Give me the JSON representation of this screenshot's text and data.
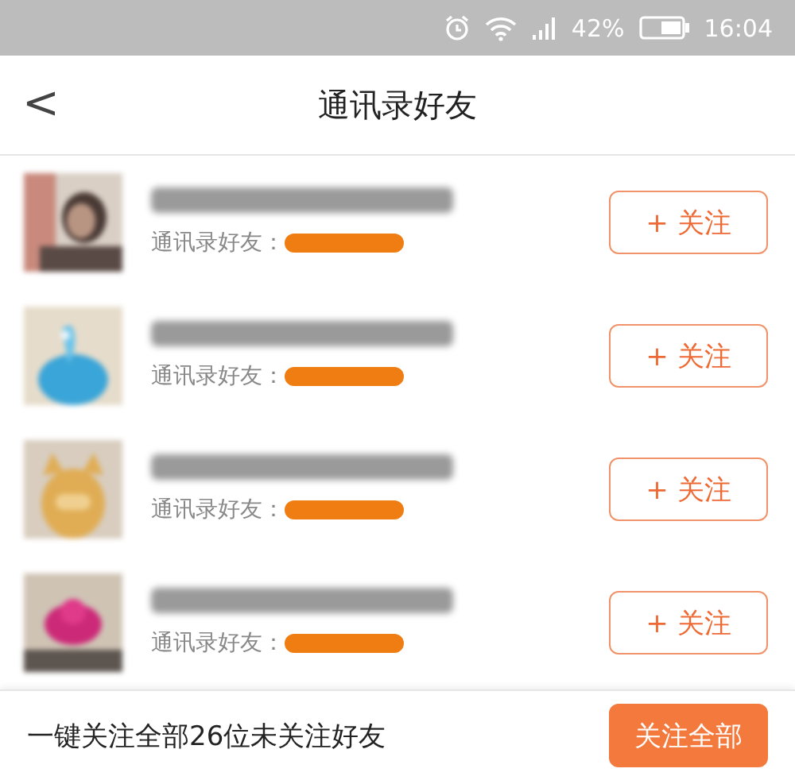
{
  "status_bar": {
    "battery": "42%",
    "time": "16:04"
  },
  "header": {
    "back": "<",
    "title": "通讯录好友"
  },
  "friends": [
    {
      "source_label": "通讯录好友：",
      "follow_button": "+ 关注"
    },
    {
      "source_label": "通讯录好友：",
      "follow_button": "+ 关注"
    },
    {
      "source_label": "通讯录好友：",
      "follow_button": "+ 关注"
    },
    {
      "source_label": "通讯录好友：",
      "follow_button": "+ 关注"
    }
  ],
  "footer": {
    "summary": "一键关注全部26位未关注好友",
    "follow_all_button": "关注全部"
  }
}
